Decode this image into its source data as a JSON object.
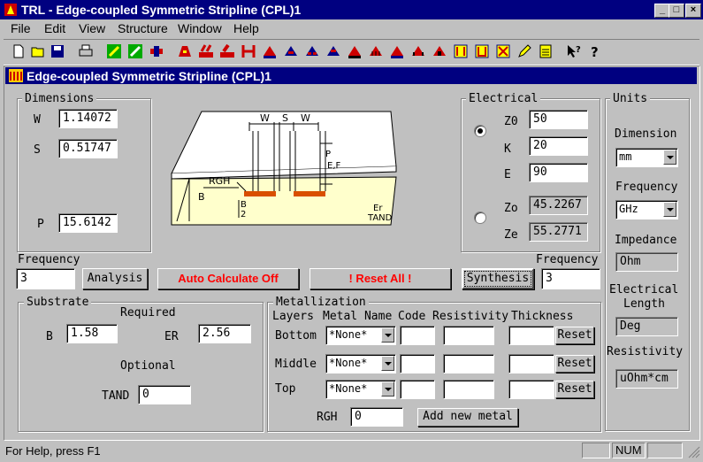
{
  "window": {
    "title": "TRL - Edge-coupled Symmetric Stripline   (CPL)1",
    "btn_min": "_",
    "btn_max": "□",
    "btn_close": "×"
  },
  "menu": [
    "File",
    "Edit",
    "View",
    "Structure",
    "Window",
    "Help"
  ],
  "toolbar_icons": [
    "new-icon",
    "open-icon",
    "save-icon",
    "print-icon",
    "tool-a-icon",
    "tool-b-icon",
    "tool-c-icon",
    "line-a-icon",
    "line-b-icon",
    "line-c-icon",
    "line-d-icon",
    "line-e-icon",
    "line-f-icon",
    "line-g-icon",
    "line-h-icon",
    "line-i-icon",
    "line-j-icon",
    "line-k-icon",
    "line-l-icon",
    "line-m-icon",
    "line-n-icon",
    "line-o-icon",
    "line-p-icon",
    "line-q-icon",
    "pencil-icon",
    "calculator-icon",
    "context-help-icon",
    "help-icon"
  ],
  "child": {
    "title": "Edge-coupled Symmetric Stripline  (CPL)1"
  },
  "dimensions": {
    "legend": "Dimensions",
    "w_label": "W",
    "w_value": "1.14072",
    "s_label": "S",
    "s_value": "0.51747",
    "p_label": "P",
    "p_value": "15.6142"
  },
  "diagram": {
    "w1": "W",
    "s": "S",
    "w2": "W",
    "p": "P",
    "ef": "E,F",
    "rgh": "RGH",
    "b": "B",
    "b_half_top": "B",
    "b_half_bottom": "2",
    "er": "Er",
    "tand": "TAND"
  },
  "electrical": {
    "legend": "Electrical",
    "z0_label": "Z0",
    "z0_value": "50",
    "k_label": "K",
    "k_value": "20",
    "e_label": "E",
    "e_value": "90",
    "zo_label": "Zo",
    "zo_value": "45.2267",
    "ze_label": "Ze",
    "ze_value": "55.2771"
  },
  "units": {
    "legend": "Units",
    "dimension_label": "Dimension",
    "dimension_value": "mm",
    "frequency_label": "Frequency",
    "frequency_value": "GHz",
    "impedance_label": "Impedance",
    "impedance_value": "Ohm",
    "elec_length_label_1": "Electrical",
    "elec_length_label_2": "Length",
    "elec_length_value": "Deg",
    "resistivity_label": "Resistivity",
    "resistivity_value": "uOhm*cm"
  },
  "controls": {
    "frequency_left_label": "Frequency",
    "frequency_left_value": "3",
    "analysis": "Analysis",
    "auto_calc": "Auto Calculate Off",
    "reset_all": "!   Reset  All  !",
    "synthesis": "Synthesis",
    "frequency_right_label": "Frequency",
    "frequency_right_value": "3"
  },
  "substrate": {
    "legend": "Substrate",
    "required": "Required",
    "b_label": "B",
    "b_value": "1.58",
    "er_label": "ER",
    "er_value": "2.56",
    "optional": "Optional",
    "tand_label": "TAND",
    "tand_value": "0"
  },
  "metallization": {
    "legend": "Metallization",
    "headers": [
      "Layers",
      "Metal Name",
      "Code",
      "Resistivity",
      "Thickness"
    ],
    "rows": [
      {
        "layer": "Bottom",
        "metal": "*None*",
        "code": "",
        "resistivity": "",
        "thickness": "",
        "reset": "Reset"
      },
      {
        "layer": "Middle",
        "metal": "*None*",
        "code": "",
        "resistivity": "",
        "thickness": "",
        "reset": "Reset"
      },
      {
        "layer": "Top",
        "metal": "*None*",
        "code": "",
        "resistivity": "",
        "thickness": "",
        "reset": "Reset"
      }
    ],
    "rgh_label": "RGH",
    "rgh_value": "0",
    "add_metal": "Add new metal"
  },
  "status": {
    "help": "For Help, press F1",
    "num": "NUM"
  },
  "colors": {
    "title_bg": "#000080",
    "auto_calc_text": "#ff0000",
    "substrate_fill": "#ffffcc",
    "strip_fill": "#d94f00"
  }
}
